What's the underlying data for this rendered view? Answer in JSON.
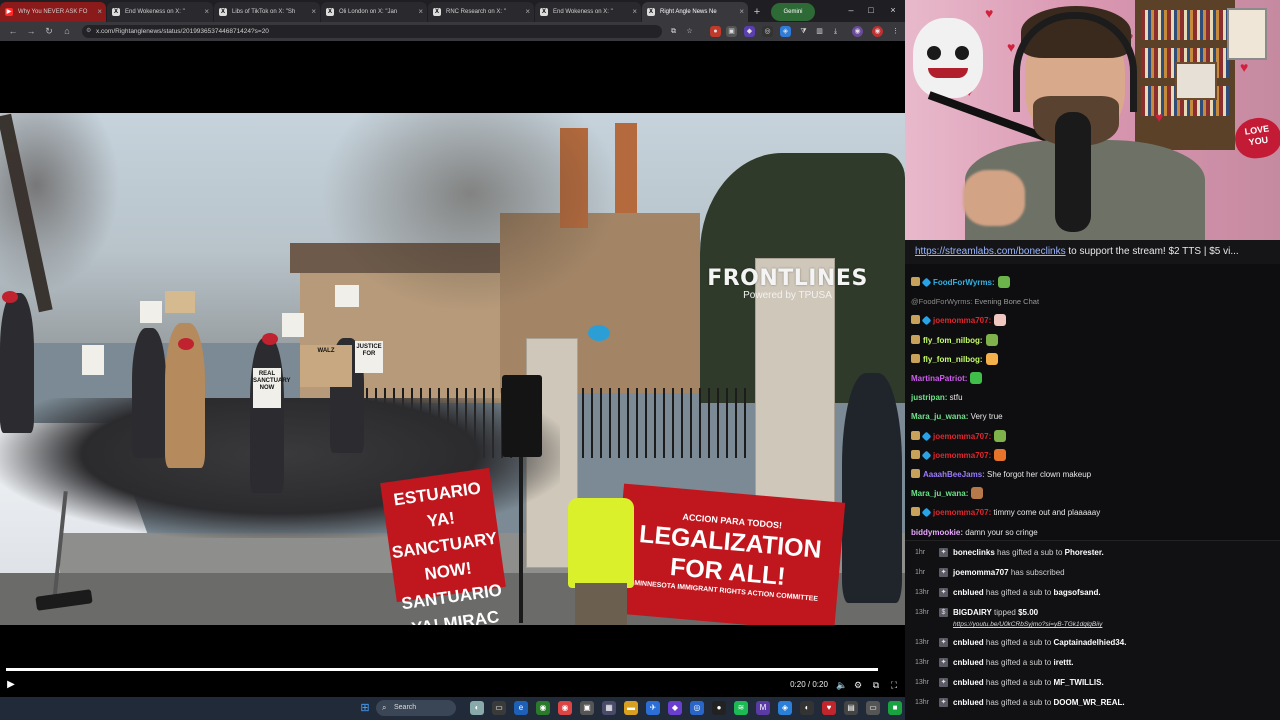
{
  "browser": {
    "tabs": [
      {
        "label": "Why You NEVER ASK FO",
        "active": false,
        "favicon": "youtube-icon"
      },
      {
        "label": "End Wokeness on X: \"",
        "active": false,
        "favicon": "x-icon"
      },
      {
        "label": "Libs of TikTok on X: \"Sh",
        "active": false,
        "favicon": "x-icon"
      },
      {
        "label": "Oli London on X: \"Jan",
        "active": false,
        "favicon": "x-icon"
      },
      {
        "label": "RNC Research on X: \"",
        "active": false,
        "favicon": "x-icon"
      },
      {
        "label": "End Wokeness on X: \"",
        "active": false,
        "favicon": "x-icon"
      },
      {
        "label": "Right Angle News Ne",
        "active": true,
        "favicon": "x-icon"
      }
    ],
    "gemini_label": "Gemini",
    "url": "x.com/Rightanglenews/status/2019936537446871424?s=20"
  },
  "video": {
    "logo_title": "FRONTLINES",
    "logo_sub": "Powered by TPUSA",
    "banner_left": "ESTUARIO YA! SANCTUARY NOW! SANTUARIO YA! MIRAC",
    "banner_right_top": "ACCION PARA TODOS!",
    "banner_right": "LEGALIZATION FOR ALL!",
    "banner_right_sub": "MINNESOTA IMMIGRANT RIGHTS ACTION COMMITTEE",
    "sign_real": "REAL SANCTUARY NOW",
    "sign_justice": "JUSTICE FOR",
    "sign_walz": "WALZ",
    "time": "0:20 / 0:20",
    "progress": 1.0
  },
  "taskbar": {
    "search_placeholder": "Search"
  },
  "stream": {
    "ticker_link": "https://streamlabs.com/boneclinks",
    "ticker_text": " to support the stream! $2 TTS | $5 vi..."
  },
  "chat": {
    "messages": [
      {
        "user": "FoodForWyrms:",
        "text": "",
        "color": "#2fb3e6",
        "badges": [
          "owl",
          "blue"
        ],
        "emote": "#6bb34a"
      },
      {
        "user": "@FoodForWyrms:",
        "text": "Evening Bone Chat",
        "color": "#8a8a8a",
        "reply": true
      },
      {
        "user": "joemomma707:",
        "text": "",
        "color": "#e0262d",
        "badges": [
          "owl",
          "blue"
        ],
        "emote": "#f0c7c0"
      },
      {
        "user": "fly_fom_nilbog:",
        "text": "",
        "color": "#c8ff6a",
        "badges": [
          "owl"
        ],
        "emote": "#7fb24b"
      },
      {
        "user": "fly_fom_nilbog:",
        "text": "",
        "color": "#c8ff6a",
        "badges": [
          "owl"
        ],
        "emote": "#f4b04a"
      },
      {
        "user": "MartinaPatriot:",
        "text": "",
        "color": "#d15cf0",
        "badges": [],
        "emote": "#3fbf4a"
      },
      {
        "user": "justripan:",
        "text": "stfu",
        "color": "#6fe28a",
        "badges": []
      },
      {
        "user": "Mara_ju_wana:",
        "text": "Very true",
        "color": "#6fe28a",
        "badges": []
      },
      {
        "user": "joemomma707:",
        "text": "",
        "color": "#e0262d",
        "badges": [
          "owl",
          "blue"
        ],
        "emote": "#7fb24b"
      },
      {
        "user": "joemomma707:",
        "text": "",
        "color": "#e0262d",
        "badges": [
          "owl",
          "blue"
        ],
        "emote": "#e8742c"
      },
      {
        "user": "AaaahBeeJams:",
        "text": "She forgot her clown makeup",
        "color": "#9a7cff",
        "badges": [
          "owl"
        ]
      },
      {
        "user": "Mara_ju_wana:",
        "text": "",
        "color": "#6fe28a",
        "badges": [],
        "emote": "#b8794a"
      },
      {
        "user": "joemomma707:",
        "text": "timmy come out and plaaaaay",
        "color": "#e0262d",
        "badges": [
          "owl",
          "blue"
        ]
      },
      {
        "user": "biddymookie:",
        "text": "damn your so cringe",
        "color": "#e8a8ff",
        "badges": []
      }
    ]
  },
  "events": [
    {
      "age": "1hr",
      "user": "boneclinks",
      "text": " has gifted a sub to ",
      "target": "Phorester."
    },
    {
      "age": "1hr",
      "user": "joemomma707",
      "text": " has subscribed",
      "target": ""
    },
    {
      "age": "13hr",
      "user": "cnblued",
      "text": " has gifted a sub to ",
      "target": "bagsofsand."
    },
    {
      "age": "13hr",
      "user": "BIGDAIRY",
      "text": " tipped ",
      "target": "$5.00",
      "link": "https://youtu.be/U0kCRbSyjmo?si=yB-TGk1dqlgBiiy"
    },
    {
      "age": "13hr",
      "user": "cnblued",
      "text": " has gifted a sub to ",
      "target": "Captainadelhied34."
    },
    {
      "age": "13hr",
      "user": "cnblued",
      "text": " has gifted a sub to ",
      "target": "irettt."
    },
    {
      "age": "13hr",
      "user": "cnblued",
      "text": " has gifted a sub to ",
      "target": "MF_TWILLIS."
    },
    {
      "age": "13hr",
      "user": "cnblued",
      "text": " has gifted a sub to ",
      "target": "DOOM_WR_REAL."
    }
  ],
  "colors": {
    "chrome_bg": "#1f1f23",
    "gemini": "#2d6a35",
    "banner_red": "#c0161e",
    "vest_yellow": "#d9f02a",
    "ticker_link": "#9ab6ff"
  }
}
